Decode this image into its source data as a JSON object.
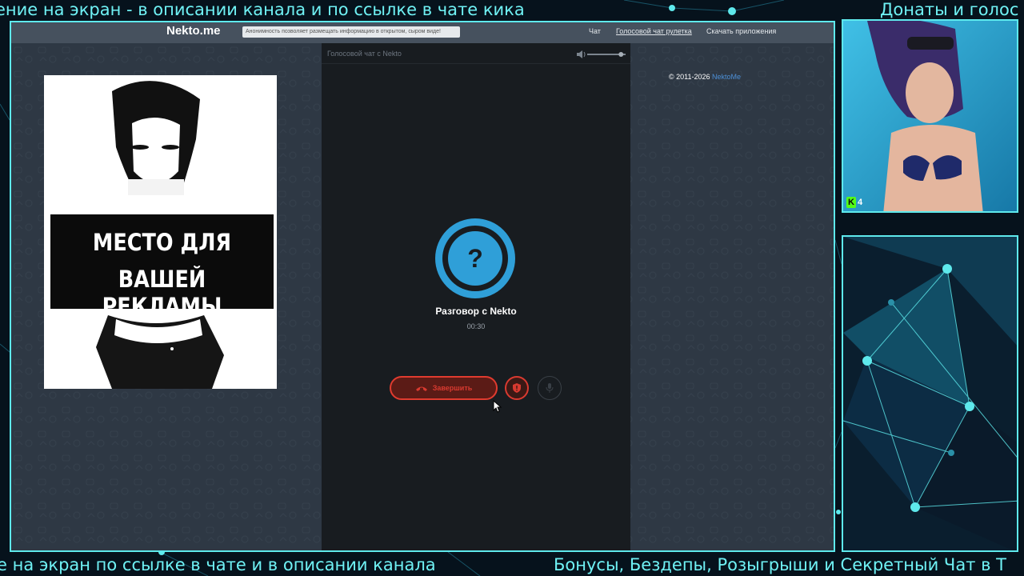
{
  "tickers": {
    "top_left": "ение на экран - в описании канала и по ссылке в чате кика",
    "top_right": "Донаты и голос",
    "bottom_left": "е на экран по ссылке в чате и в описании канала",
    "bottom_right": "Бонусы, Бездепы, Розыгрыши и Секретный Чат в Т"
  },
  "site": {
    "logo": "Nekto.me",
    "notice": "Анонимность позволяет размещать информацию в открытом, сыром виде!",
    "nav": {
      "chat": "Чат",
      "voice_roulette": "Голосовой чат рулетка",
      "download_apps": "Скачать приложения"
    },
    "copyright_prefix": "© 2011-2026",
    "copyright_link": "NektoMe"
  },
  "ad": {
    "line1": "МЕСТО ДЛЯ",
    "line2": "ВАШЕЙ РЕКЛАМЫ"
  },
  "call": {
    "header_title": "Голосовой чат с Nekto",
    "avatar_symbol": "?",
    "partner_name": "Разговор с Nekto",
    "timer": "00:30",
    "end_label": "Завершить",
    "volume_level": 0.88
  },
  "stream": {
    "viewer_count": "4",
    "platform_badge": "K"
  },
  "icons": [
    "phone-hangup-icon",
    "shield-report-icon",
    "microphone-icon",
    "volume-icon",
    "question-icon",
    "cursor-arrow-icon"
  ],
  "colors": {
    "accent_cyan": "#5ee9ec",
    "avatar_blue": "#2f9fd8",
    "end_call_red": "#e03b2f",
    "kick_green": "#53fc18"
  }
}
